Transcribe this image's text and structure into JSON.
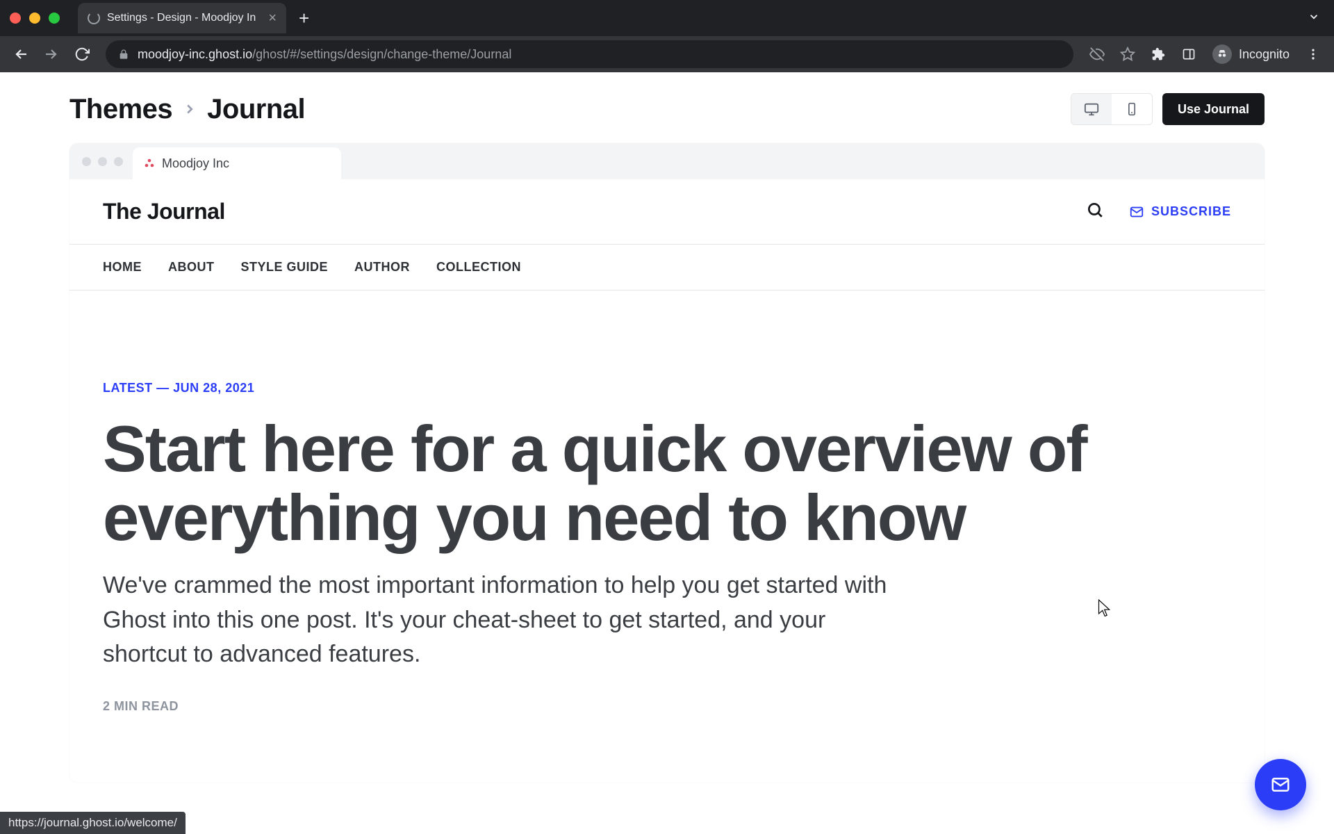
{
  "browser": {
    "tab_title": "Settings - Design - Moodjoy In",
    "url_domain": "moodjoy-inc.ghost.io",
    "url_path": "/ghost/#/settings/design/change-theme/Journal",
    "incognito_label": "Incognito",
    "status_link": "https://journal.ghost.io/welcome/"
  },
  "breadcrumb": {
    "root": "Themes",
    "current": "Journal"
  },
  "actions": {
    "use_theme_label": "Use Journal"
  },
  "preview_tab": {
    "label": "Moodjoy Inc"
  },
  "site": {
    "title": "The Journal",
    "subscribe_label": "SUBSCRIBE",
    "nav": {
      "home": "HOME",
      "about": "ABOUT",
      "style_guide": "STYLE GUIDE",
      "author": "AUTHOR",
      "collection": "COLLECTION"
    }
  },
  "hero": {
    "latest_label": "LATEST — JUN 28, 2021",
    "title": "Start here for a quick overview of everything you need to know",
    "excerpt": "We've crammed the most important information to help you get started with Ghost into this one post. It's your cheat-sheet to get started, and your shortcut to advanced features.",
    "read_time": "2 MIN READ"
  },
  "colors": {
    "accent": "#2b3df6"
  }
}
